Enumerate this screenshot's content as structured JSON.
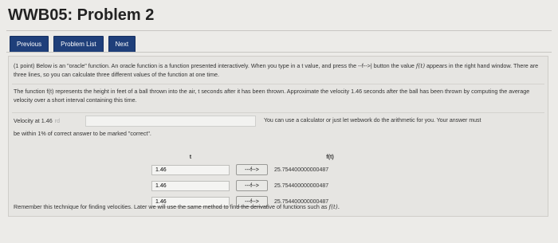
{
  "title": "WWB05: Problem 2",
  "nav": {
    "previous": "Previous",
    "problem_list": "Problem List",
    "next": "Next"
  },
  "problem": {
    "intro_a": "(1 point) Below is an \"oracle\" function. An oracle function is a function presented interactively. When you type in a t value, and press the --f-->| button the value",
    "intro_fn": "f(t)",
    "intro_b": "appears in the right hand window. There are three lines, so you can calculate three different values of the function at one time.",
    "desc_a": "The function f(t) represents the height in feet of a ball thrown into the air, t seconds after it has been thrown. Approximate the velocity 1.46 seconds after the ball",
    "desc_b": "has been thrown by computing the average velocity over a short interval containing this time.",
    "velocity_label": "Velocity at 1.46",
    "velocity_mark": "rd",
    "velocity_value": "",
    "calc_note": "You can use a calculator or just let webwork do the arithmetic for you. Your answer must",
    "tolerance": "be within 1% of correct answer to be marked \"correct\".",
    "footer_a": "Remember this technique for finding velocities. Later we will use the same method to find the derivative of functions such as",
    "footer_fn": "f(t)."
  },
  "oracle": {
    "col_t": "t",
    "col_f": "f(t)",
    "button_label": "---f-->",
    "rows": [
      {
        "t": "1.46",
        "f": "25.754400000000487"
      },
      {
        "t": "1.46",
        "f": "25.754400000000487"
      },
      {
        "t": "1.46",
        "f": "25.754400000000487"
      }
    ]
  }
}
